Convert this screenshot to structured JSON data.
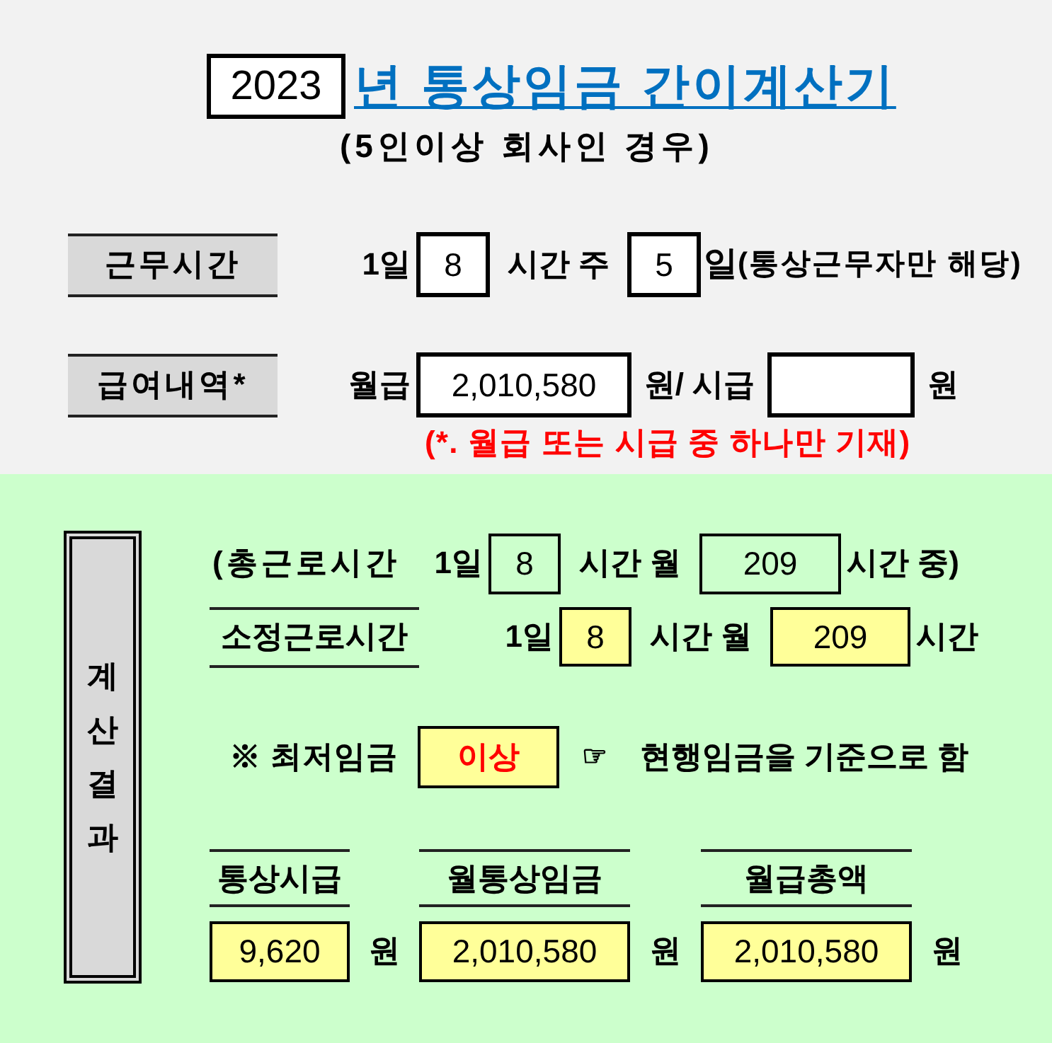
{
  "header": {
    "year": "2023",
    "title": "년 통상임금 간이계산기",
    "subtitle": "(5인이상 회사인 경우)"
  },
  "work_hours": {
    "label": "근무시간",
    "day_text": "1일",
    "hours_per_day": "8",
    "hours_unit": "시간 주",
    "days_per_week": "5",
    "days_unit": "일",
    "note": "(통상근무자만 해당)"
  },
  "wage": {
    "label": "급여내역*",
    "monthly_text": "월급",
    "monthly_wage": "2,010,580",
    "monthly_unit": "원/ 시급",
    "hourly_unit": "원",
    "note": "(*. 월급 또는 시급 중 하나만 기재)"
  },
  "results": {
    "label": "계산결과",
    "total_hours": {
      "prefix": "(총근로시간",
      "day_text": "1일",
      "hours_per_day": "8",
      "mid": "시간 월",
      "hours_per_month": "209",
      "suffix": "시간 중)"
    },
    "scheduled_hours": {
      "label": "소정근로시간",
      "day_text": "1일",
      "hours_per_day": "8",
      "mid": "시간 월",
      "hours_per_month": "209",
      "suffix": "시간"
    },
    "minimum_wage": {
      "label": "※ 최저임금",
      "status": "이상",
      "pointer": "☞",
      "note": "현행임금을 기준으로 함"
    },
    "amounts": [
      {
        "label": "통상시급",
        "value": "9,620",
        "unit": "원"
      },
      {
        "label": "월통상임금",
        "value": "2,010,580",
        "unit": "원"
      },
      {
        "label": "월급총액",
        "value": "2,010,580",
        "unit": "원"
      }
    ]
  }
}
